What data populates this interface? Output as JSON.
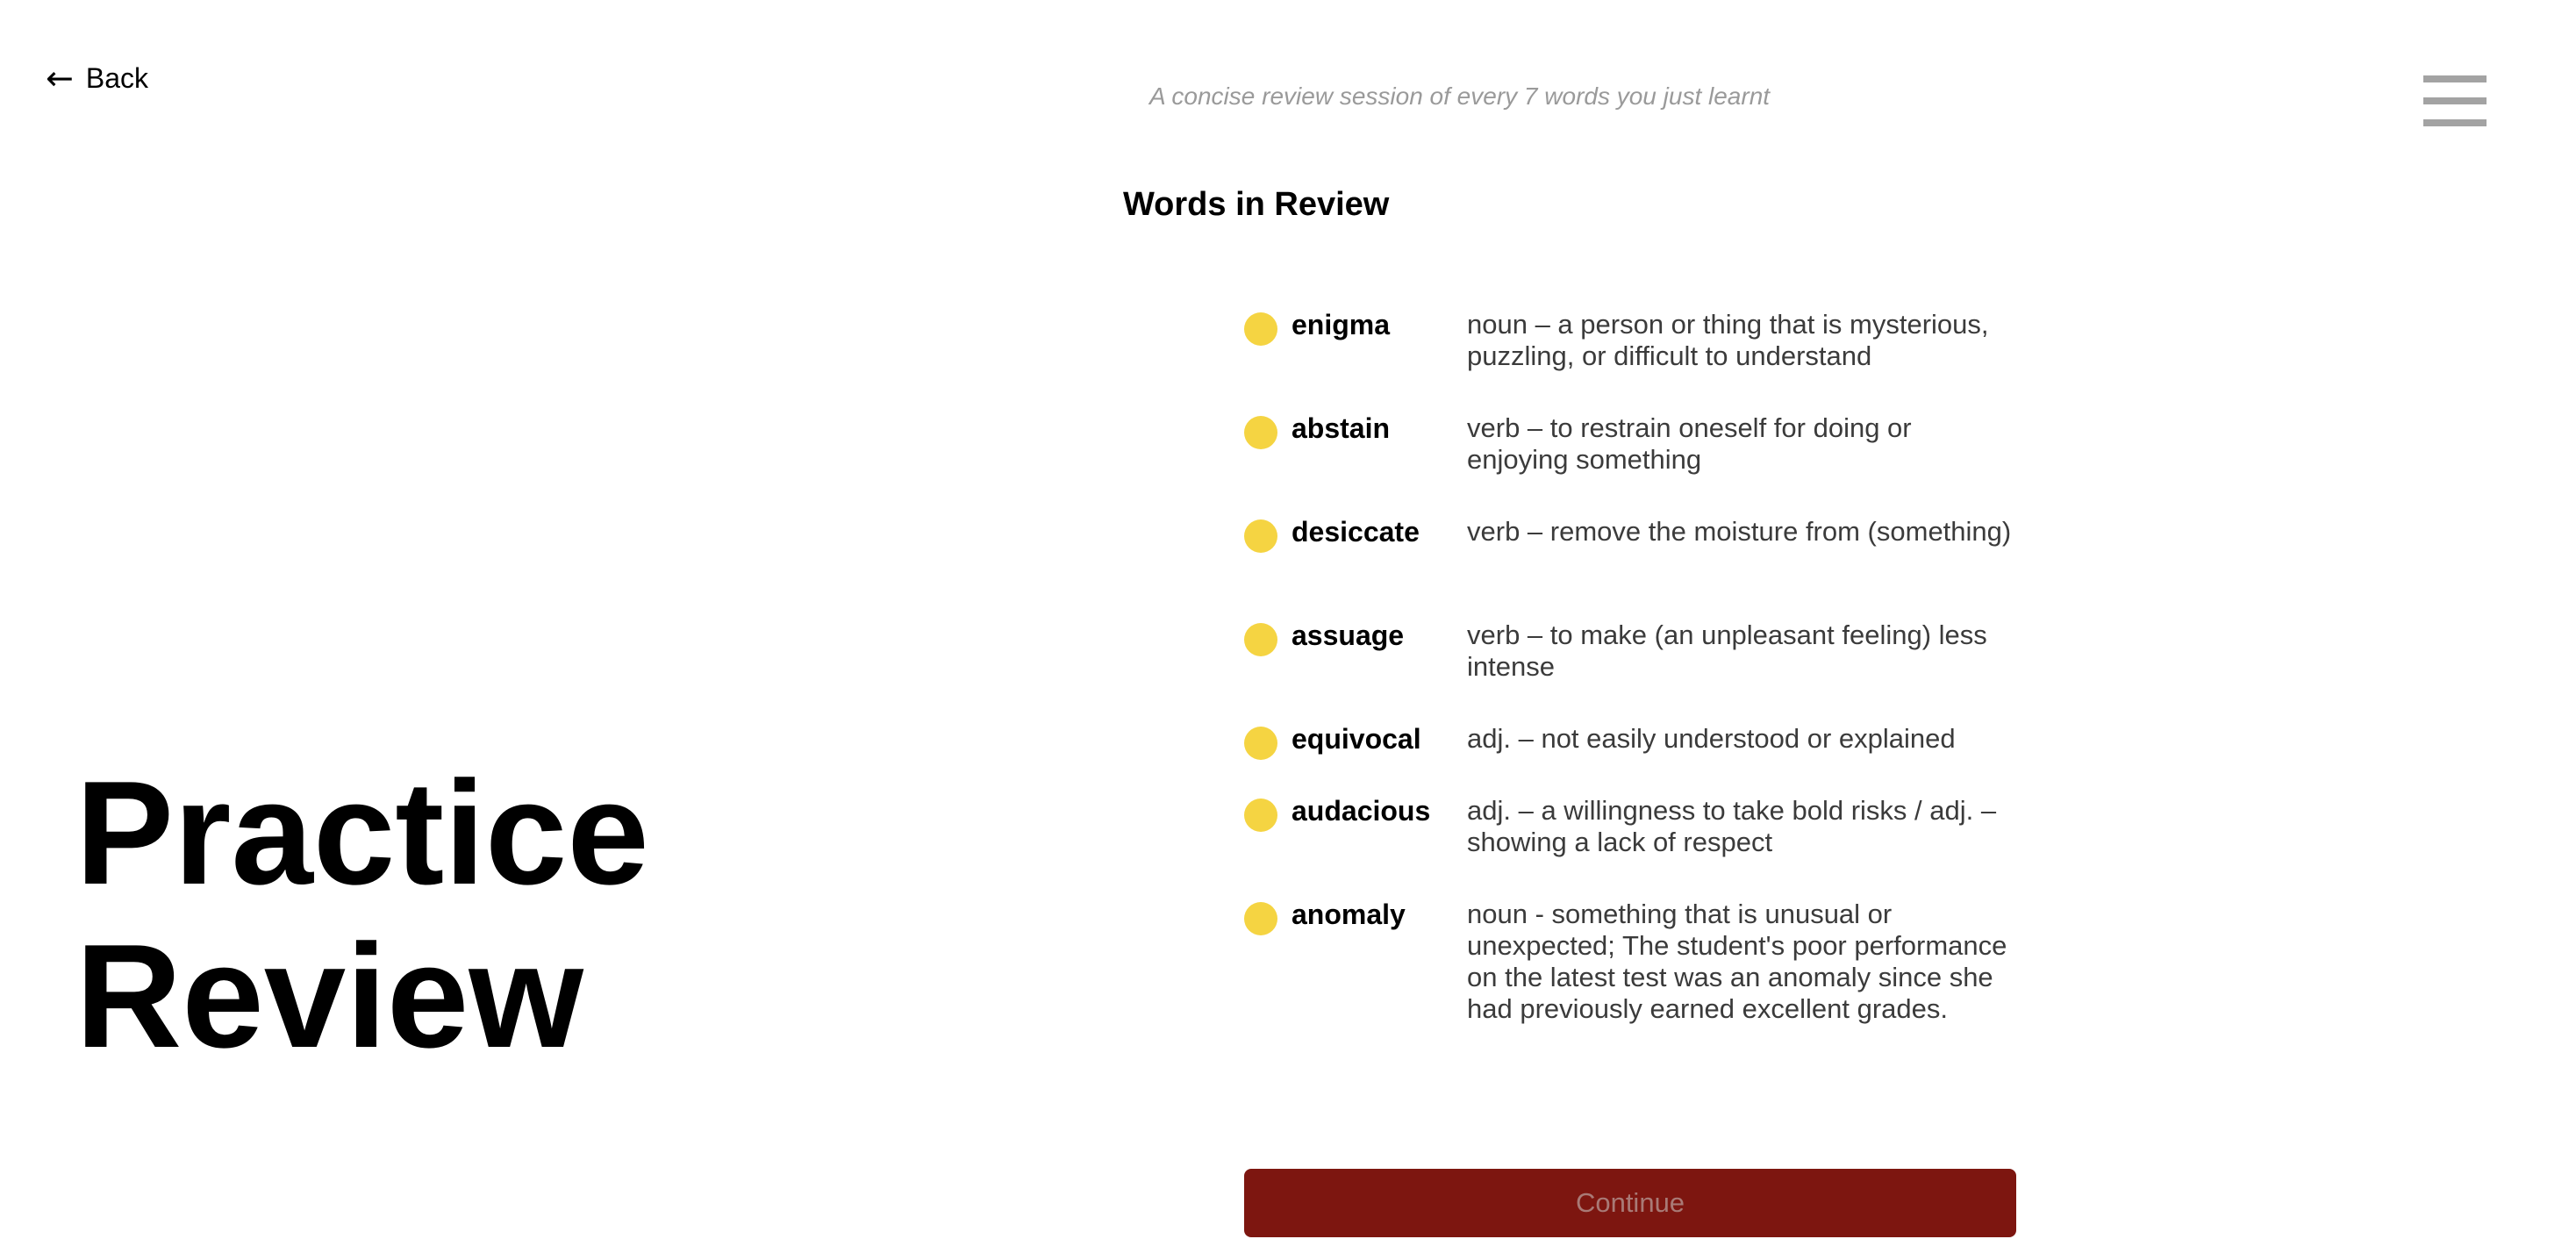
{
  "nav": {
    "back_arrow": "←",
    "back_label": "Back",
    "menu_icon": "hamburger-menu-icon"
  },
  "header": {
    "subtitle": "A concise review session of every 7 words you just learnt"
  },
  "hero": {
    "line1": "Practice",
    "line2": "Review"
  },
  "review": {
    "title": "Words in Review",
    "bullet_color": "#f5d442",
    "words": [
      {
        "term": "enigma",
        "definition": "noun – a person or thing that is mysterious, puzzling, or difficult to understand"
      },
      {
        "term": "abstain",
        "definition": "verb – to restrain oneself for doing or enjoying something"
      },
      {
        "term": "desiccate",
        "definition": "verb – remove the moisture from (something)"
      },
      {
        "term": "assuage",
        "definition": "verb – to make (an unpleasant feeling) less intense"
      },
      {
        "term": "equivocal",
        "definition": "adj. – not easily understood or explained"
      },
      {
        "term": "audacious",
        "definition": "adj. – a willingness to take bold risks / adj. – showing a lack of respect"
      },
      {
        "term": "anomaly",
        "definition": "noun - something that is unusual or unexpected; The student's poor performance on the latest test was an anomaly since she had previously earned excellent grades."
      }
    ]
  },
  "footer": {
    "continue_label": "Continue",
    "continue_color": "#7d1610"
  }
}
